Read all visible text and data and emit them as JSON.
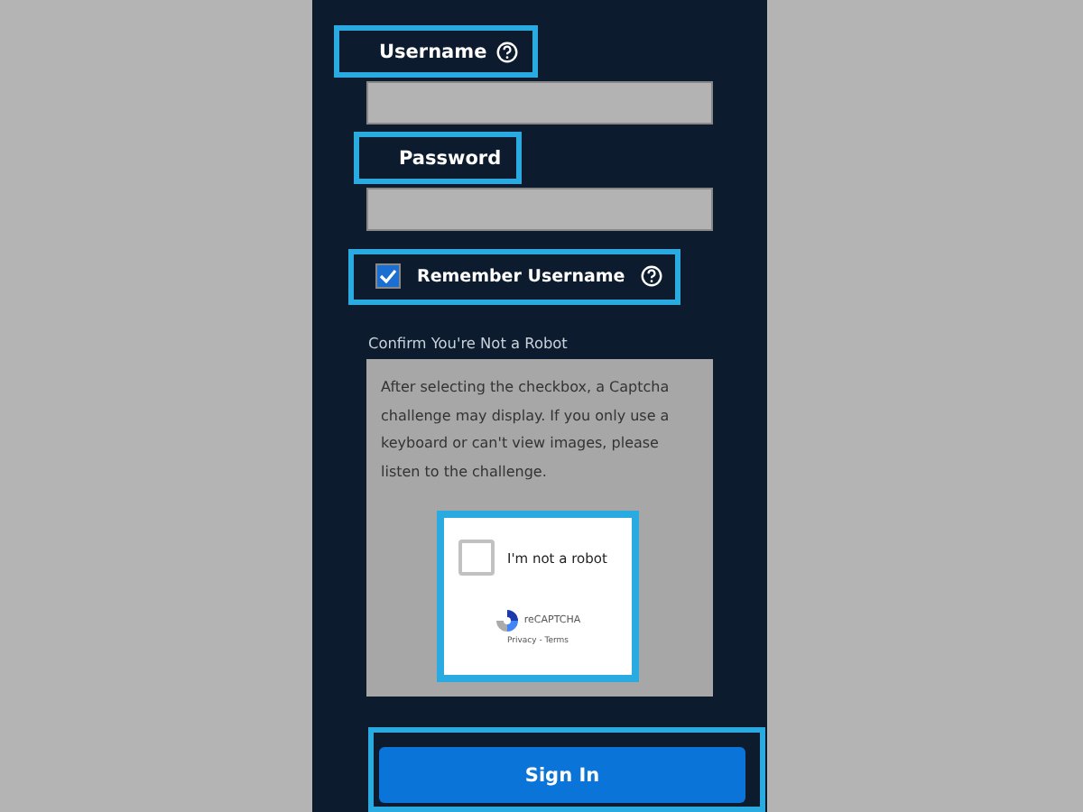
{
  "fields": [
    {
      "label": "Username",
      "help_icon": true,
      "highlighted": true
    },
    {
      "label": "Password",
      "help_icon": false,
      "highlighted": true
    }
  ],
  "remember": {
    "label": "Remember Username",
    "checked": true,
    "help_icon": true,
    "highlighted": true
  },
  "captcha": {
    "heading": "Confirm You're Not a Robot",
    "instructions": "After selecting the checkbox, a Captcha challenge may display. If you only use a keyboard or can't view images, please listen to the challenge.",
    "checkbox_label": "I'm not a robot",
    "checked": false,
    "brand": "reCAPTCHA",
    "links": "Privacy - Terms",
    "highlighted": true
  },
  "sign_in": {
    "label": "Sign In",
    "highlighted": true
  }
}
